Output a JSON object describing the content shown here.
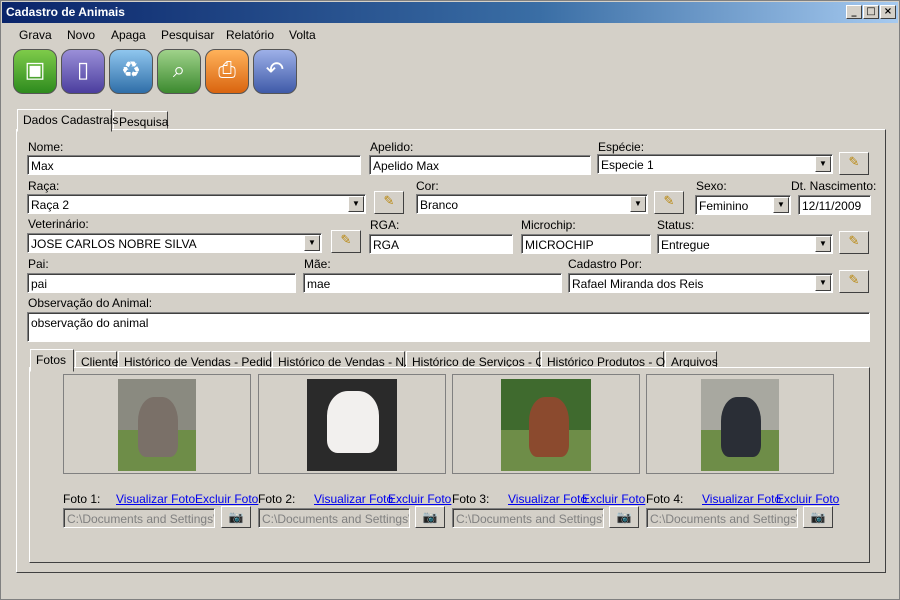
{
  "window": {
    "title": "Cadastro de Animais"
  },
  "menu": [
    "Grava",
    "Novo",
    "Apaga",
    "Pesquisar",
    "Relatório",
    "Volta"
  ],
  "toolbar_icons": [
    "save-icon",
    "new-document-icon",
    "recycle-bin-icon",
    "search-icon",
    "printer-icon",
    "back-arrow-icon"
  ],
  "outer_tabs": [
    "Dados Cadastrais",
    "Pesquisa"
  ],
  "form": {
    "nome": {
      "label": "Nome:",
      "value": "Max"
    },
    "apelido": {
      "label": "Apelido:",
      "value": "Apelido Max"
    },
    "especie": {
      "label": "Espécie:",
      "value": "Especie 1"
    },
    "raca": {
      "label": "Raça:",
      "value": "Raça 2"
    },
    "cor": {
      "label": "Cor:",
      "value": "Branco"
    },
    "sexo": {
      "label": "Sexo:",
      "value": "Feminino"
    },
    "nascimento": {
      "label": "Dt. Nascimento:",
      "value": "12/11/2009"
    },
    "veterinario": {
      "label": "Veterinário:",
      "value": "JOSE CARLOS NOBRE SILVA"
    },
    "rga": {
      "label": "RGA:",
      "value": "RGA"
    },
    "microchip": {
      "label": "Microchip:",
      "value": "MICROCHIP"
    },
    "status": {
      "label": "Status:",
      "value": "Entregue"
    },
    "pai": {
      "label": "Pai:",
      "value": "pai"
    },
    "mae": {
      "label": "Mãe:",
      "value": "mae"
    },
    "cadastro_por": {
      "label": "Cadastro Por:",
      "value": "Rafael Miranda dos Reis"
    },
    "observacao": {
      "label": "Observação do Animal:",
      "value": "observação do animal"
    }
  },
  "inner_tabs": [
    "Fotos",
    "Cliente",
    "Histórico de Vendas - Pedidos",
    "Histórico de Vendas - N.F",
    "Histórico de Serviços - OS",
    "Histórico Produtos - O.S",
    "Arquivos"
  ],
  "photos": [
    {
      "label": "Foto 1:",
      "view": "Visualizar Foto",
      "delete": "Excluir Foto",
      "path": "C:\\Documents and Settings\\U"
    },
    {
      "label": "Foto 2:",
      "view": "Visualizar Foto",
      "delete": "Excluir Foto",
      "path": "C:\\Documents and Settings\\U"
    },
    {
      "label": "Foto 3:",
      "view": "Visualizar Foto",
      "delete": "Excluir Foto",
      "path": "C:\\Documents and Settings\\U"
    },
    {
      "label": "Foto 4:",
      "view": "Visualizar Foto",
      "delete": "Excluir Foto",
      "path": "C:\\Documents and Settings\\U"
    }
  ]
}
